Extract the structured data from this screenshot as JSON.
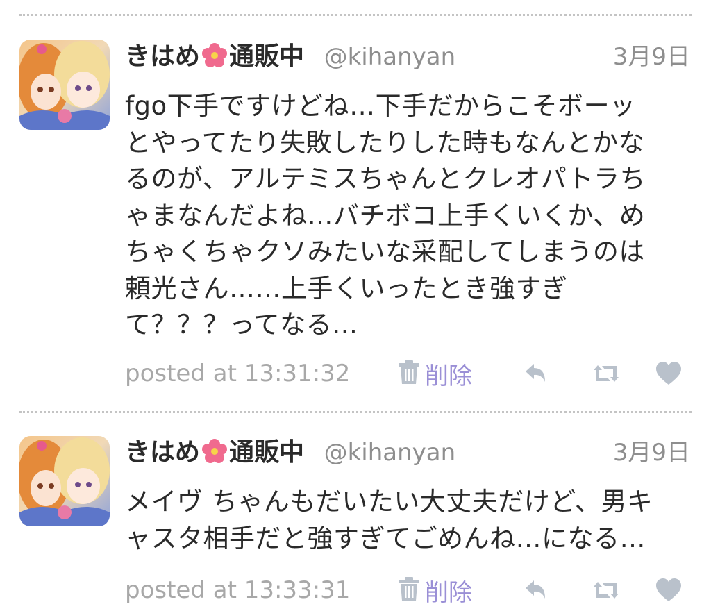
{
  "tweets": [
    {
      "author": "きはめ",
      "flower_emoji": "🌺",
      "author_suffix": "通販中",
      "handle": "@kihanyan",
      "date": "3月9日",
      "text": "fgo下手ですけどね…下手だからこそボーッ\nとやってたり失敗したりした時もなんとかな\nるのが、アルテミスちゃんとクレオパトラち\nゃまなんだよね…バチボコ上手くいくか、め\nちゃくちゃクソみたいな采配してしまうのは\n頼光さん……上手くいったとき強すぎ\nて？？？ってなる…",
      "posted": "posted at 13:31:32",
      "delete_label": "削除"
    },
    {
      "author": "きはめ",
      "flower_emoji": "🌺",
      "author_suffix": "通販中",
      "handle": "@kihanyan",
      "date": "3月9日",
      "text": "メイヴ ちゃんもだいたい大丈夫だけど、男キ\nャスタ相手だと強すぎてごめんね…になる…",
      "posted": "posted at 13:33:31",
      "delete_label": "削除"
    }
  ],
  "icons": {
    "delete": "trash-icon",
    "reply": "reply-icon",
    "retweet": "retweet-icon",
    "like": "heart-icon"
  },
  "colors": {
    "text": "#2a2a2a",
    "muted": "#8e8e8e",
    "posted": "#a8a8a8",
    "delete": "#9a8fd6",
    "icon": "#b9c1cb",
    "divider": "#c4c4c4"
  }
}
